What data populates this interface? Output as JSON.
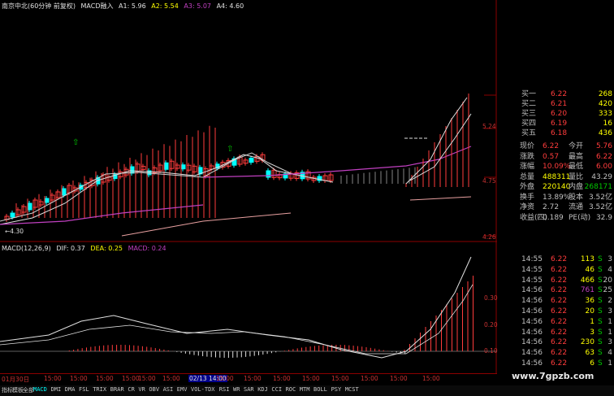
{
  "header": {
    "title": "南京中北(60分钟 前复权)",
    "indicator": "MACD融入",
    "a1": "A1: 5.96",
    "a2": "A2: 5.54",
    "a3": "A3: 5.07",
    "a4": "A4: 4.60"
  },
  "colors": {
    "up": "#ff3c3c",
    "down": "#00ffff",
    "white": "#e0e0e0",
    "magenta": "#c040c0",
    "yellow": "#ffff00",
    "green": "#00c800",
    "axis": "#8b0000"
  },
  "price_axis": {
    "top": "5.24",
    "mid": "4.75",
    "bottom": "4.26"
  },
  "low_marker": "4.30",
  "macd_header": {
    "name": "MACD(12,26,9)",
    "dif": "DIF: 0.37",
    "dea": "DEA: 0.25",
    "macd": "MACD: 0.24"
  },
  "macd_axis": {
    "v1": "0.30",
    "v2": "0.20",
    "v3": "0.10"
  },
  "quote": {
    "bids": [
      {
        "label": "买一",
        "price": "6.22",
        "vol": "268"
      },
      {
        "label": "买二",
        "price": "6.21",
        "vol": "420"
      },
      {
        "label": "买三",
        "price": "6.20",
        "vol": "333"
      },
      {
        "label": "买四",
        "price": "6.19",
        "vol": "16"
      },
      {
        "label": "买五",
        "price": "6.18",
        "vol": "436"
      }
    ],
    "stats": [
      {
        "l1": "现价",
        "v1": "6.22",
        "l2": "今开",
        "v2": "5.76"
      },
      {
        "l1": "涨跌",
        "v1": "0.57",
        "l2": "最高",
        "v2": "6.22"
      },
      {
        "l1": "涨幅",
        "v1": "10.09%",
        "l2": "最低",
        "v2": "6.00"
      },
      {
        "l1": "总量",
        "v1": "488311",
        "l2": "量比",
        "v2": "43.29"
      },
      {
        "l1": "外盘",
        "v1": "220140",
        "l2": "内盘",
        "v2": "268171"
      },
      {
        "l1": "换手",
        "v1": "13.89%",
        "l2": "股本",
        "v2": "3.52亿"
      },
      {
        "l1": "净资",
        "v1": "2.72",
        "l2": "流通",
        "v2": "3.52亿"
      },
      {
        "l1": "收益(四)",
        "v1": "0.189",
        "l2": "PE(动)",
        "v2": "32.9"
      }
    ],
    "ticks": [
      {
        "t": "14:55",
        "p": "6.22",
        "v": "113",
        "s": "S",
        "n": "3"
      },
      {
        "t": "14:55",
        "p": "6.22",
        "v": "46",
        "s": "S",
        "n": "4"
      },
      {
        "t": "14:55",
        "p": "6.22",
        "v": "466",
        "s": "S",
        "n": "20"
      },
      {
        "t": "14:56",
        "p": "6.22",
        "v": "761",
        "s": "S",
        "n": "25"
      },
      {
        "t": "14:56",
        "p": "6.22",
        "v": "36",
        "s": "S",
        "n": "2"
      },
      {
        "t": "14:56",
        "p": "6.22",
        "v": "20",
        "s": "S",
        "n": "3"
      },
      {
        "t": "14:56",
        "p": "6.22",
        "v": "1",
        "s": "S",
        "n": "1"
      },
      {
        "t": "14:56",
        "p": "6.22",
        "v": "3",
        "s": "S",
        "n": "1"
      },
      {
        "t": "14:56",
        "p": "6.22",
        "v": "230",
        "s": "S",
        "n": "3"
      },
      {
        "t": "14:56",
        "p": "6.22",
        "v": "63",
        "s": "S",
        "n": "4"
      },
      {
        "t": "14:56",
        "p": "6.22",
        "v": "6",
        "s": "S",
        "n": "1"
      }
    ]
  },
  "timeline": [
    "01月30日",
    "15:00",
    "15:00",
    "15:00",
    "15:00",
    "15:00",
    "15:00",
    "02/13 14:00",
    "15:00",
    "15:00",
    "15:00",
    "15:00",
    "15:00",
    "15:00",
    "15:00",
    "15:00"
  ],
  "tabs": [
    "指标",
    "模板",
    "全部",
    "MACD",
    "DMI",
    "DMA",
    "FSL",
    "TRIX",
    "BRAR",
    "CR",
    "VR",
    "OBV",
    "ASI",
    "EMV",
    "VOL-TDX",
    "RSI",
    "WR",
    "SAR",
    "KDJ",
    "CCI",
    "ROC",
    "MTM",
    "BOLL",
    "PSY",
    "MCST"
  ],
  "watermark": "www.7gpzb.com"
}
